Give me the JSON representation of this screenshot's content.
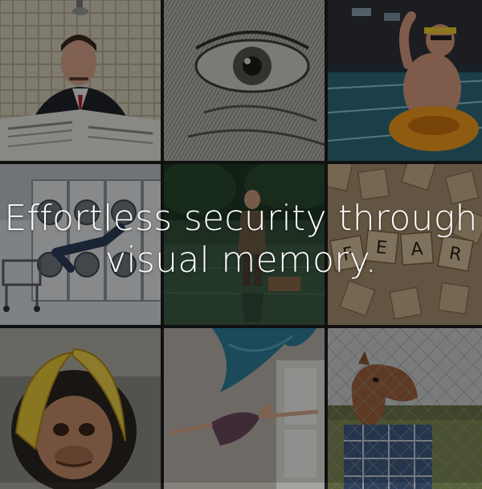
{
  "headline": {
    "line1": "Effortless security through",
    "line2": "visual memory."
  },
  "tiles": [
    {
      "label": "man-reading-newspaper"
    },
    {
      "label": "banknote-eye"
    },
    {
      "label": "man-in-swim-ring"
    },
    {
      "label": "laundromat-floating-person"
    },
    {
      "label": "man-in-water-with-briefcase"
    },
    {
      "label": "fear-letter-tiles"
    },
    {
      "label": "monkey-mask-banana"
    },
    {
      "label": "woman-falling-curtain"
    },
    {
      "label": "horse-mask-fence"
    }
  ],
  "colors": {
    "overlay": "#000000",
    "text": "#ffffff"
  }
}
